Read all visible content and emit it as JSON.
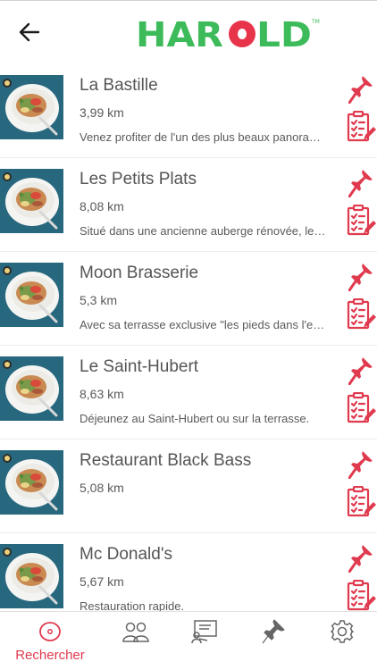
{
  "header": {
    "back_icon": "arrow-left-icon",
    "logo_text": "HAROLD",
    "logo_tm": "TM",
    "logo_colors": {
      "green": "#3dbb5a",
      "red": "#e8344b"
    }
  },
  "accent_color": "#e03a4e",
  "restaurants": [
    {
      "name": "La Bastille",
      "distance": "3,99 km",
      "description": "Venez profiter de l'un des plus beaux panoramas"
    },
    {
      "name": "Les Petits Plats",
      "distance": "8,08 km",
      "description": "Situé dans une ancienne auberge rénovée, le restaurant"
    },
    {
      "name": "Moon Brasserie",
      "distance": "5,3 km",
      "description": "Avec sa terrasse exclusive \"les pieds dans l'eau\""
    },
    {
      "name": "Le Saint-Hubert",
      "distance": "8,63 km",
      "description": "Déjeunez au Saint-Hubert ou sur la terrasse."
    },
    {
      "name": "Restaurant Black Bass",
      "distance": "5,08 km",
      "description": ""
    },
    {
      "name": "Mc Donald's",
      "distance": "5,67 km",
      "description": "Restauration rapide."
    }
  ],
  "row_icons": {
    "pin": "pushpin-icon",
    "note": "checklist-edit-icon"
  },
  "tabs": [
    {
      "icon": "target-icon",
      "label": "Rechercher",
      "active": true
    },
    {
      "icon": "people-icon",
      "label": "",
      "active": false
    },
    {
      "icon": "presentation-icon",
      "label": "",
      "active": false
    },
    {
      "icon": "pushpin-icon",
      "label": "",
      "active": false
    },
    {
      "icon": "gear-icon",
      "label": "",
      "active": false
    }
  ]
}
